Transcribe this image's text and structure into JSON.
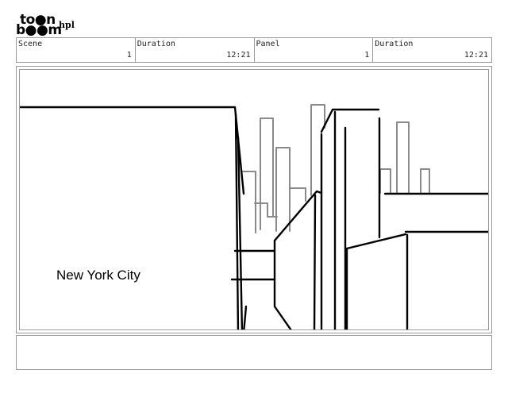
{
  "header": {
    "logo_top": "to●n",
    "logo_bottom": "b●●m",
    "project_name": "hpl"
  },
  "info": [
    {
      "label": "Scene",
      "value": "1"
    },
    {
      "label": "Duration",
      "value": "12:21"
    },
    {
      "label": "Panel",
      "value": "1"
    },
    {
      "label": "Duration",
      "value": "12:21"
    }
  ],
  "panel": {
    "caption": "New York City"
  },
  "notes": {
    "text": ""
  },
  "colors": {
    "frame": "#9a9a9a",
    "ink": "#000000",
    "background_ink": "#8a8a8a"
  }
}
